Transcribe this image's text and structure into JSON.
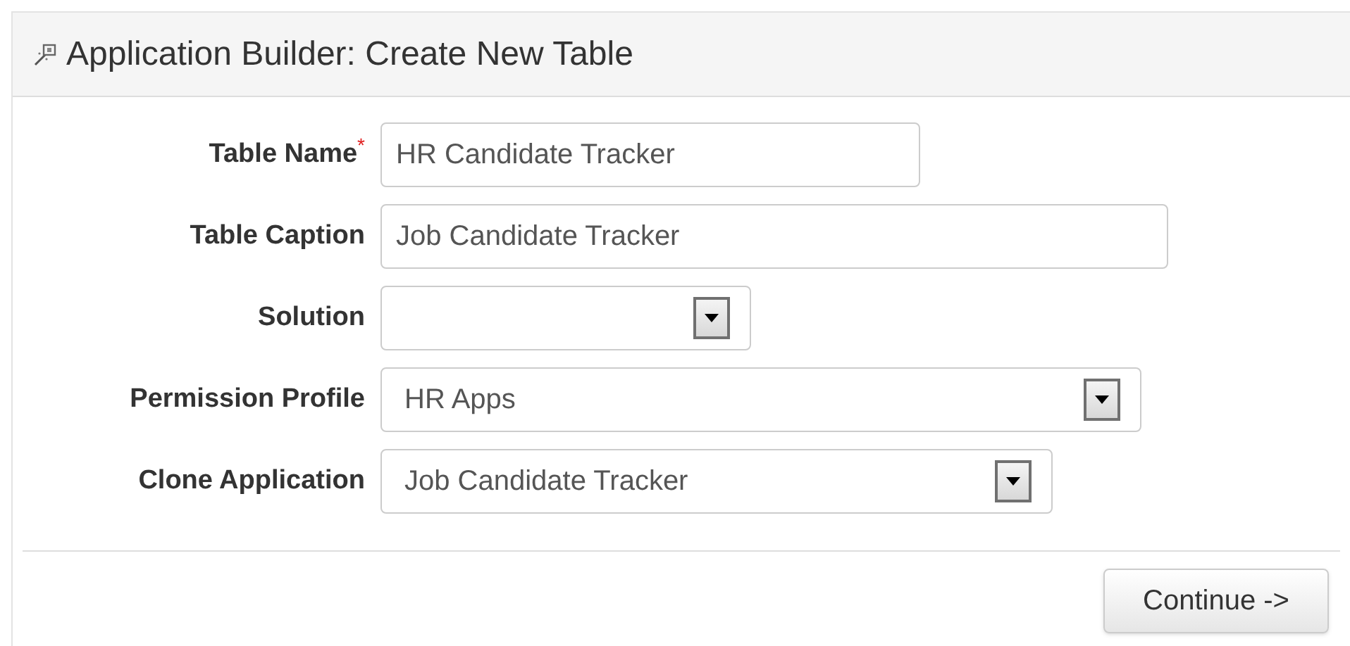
{
  "panel": {
    "title": "Application Builder: Create New Table"
  },
  "fields": [
    {
      "label": "Table Name",
      "kind": "text",
      "required_mark": "*",
      "value": "HR Candidate Tracker"
    },
    {
      "label": "Table Caption",
      "kind": "text",
      "value": "Job Candidate Tracker"
    },
    {
      "label": "Solution",
      "kind": "select"
    },
    {
      "label": "Permission Profile",
      "kind": "select",
      "value": "HR Apps"
    },
    {
      "label": "Clone Application",
      "kind": "select",
      "value": "Job Candidate Tracker"
    }
  ],
  "buttons": [
    {
      "label": "Continue ->"
    }
  ]
}
